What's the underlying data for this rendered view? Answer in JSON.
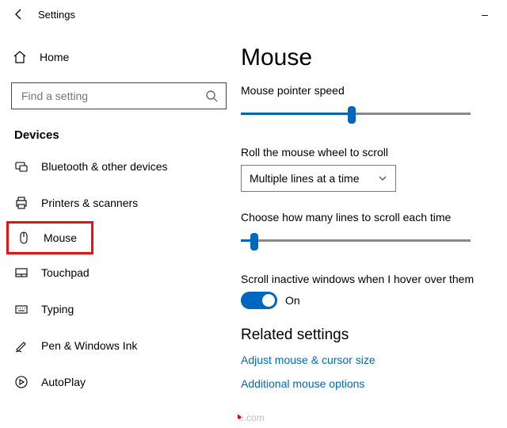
{
  "window": {
    "title": "Settings",
    "minimize": "–"
  },
  "sidebar": {
    "home": "Home",
    "search_placeholder": "Find a setting",
    "section": "Devices",
    "items": [
      {
        "icon": "bt",
        "label": "Bluetooth & other devices"
      },
      {
        "icon": "printer",
        "label": "Printers & scanners"
      },
      {
        "icon": "mouse",
        "label": "Mouse"
      },
      {
        "icon": "touchpad",
        "label": "Touchpad"
      },
      {
        "icon": "keyboard",
        "label": "Typing"
      },
      {
        "icon": "pen",
        "label": "Pen & Windows Ink"
      },
      {
        "icon": "autoplay",
        "label": "AutoPlay"
      }
    ]
  },
  "main": {
    "title": "Mouse",
    "speed_label": "Mouse pointer speed",
    "speed_value": 50,
    "wheel_label": "Roll the mouse wheel to scroll",
    "wheel_selected": "Multiple lines at a time",
    "lines_label": "Choose how many lines to scroll each time",
    "lines_value": 6,
    "hover_label": "Scroll inactive windows when I hover over them",
    "hover_on": true,
    "hover_text": "On",
    "related_heading": "Related settings",
    "link_adjust": "Adjust mouse & cursor size",
    "link_additional": "Additional mouse options"
  },
  "watermark": "©howtoedge.com"
}
